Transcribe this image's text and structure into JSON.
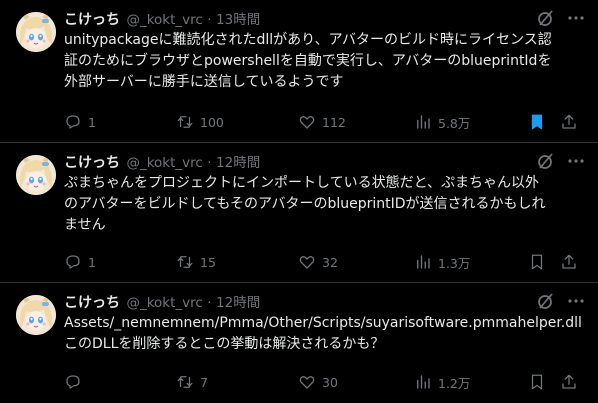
{
  "colors": {
    "background": "#000000",
    "text": "#e7e9ea",
    "muted": "#71767b",
    "accent": "#1d9bf0",
    "divider": "#2f3336"
  },
  "tweets": [
    {
      "name": "こけっち",
      "handle": "@_kokt_vrc",
      "separator": "·",
      "time": "13時間",
      "text": "unitypackageに難読化されたdllがあり、アバターのビルド時にライセンス認\n証のためにブラウザとpowershellを自動で実行し、アバターのblueprintIdを\n外部サーバーに勝手に送信しているようです",
      "replies": "1",
      "retweets": "100",
      "likes": "112",
      "views": "5.8万",
      "bookmarked": true
    },
    {
      "name": "こけっち",
      "handle": "@_kokt_vrc",
      "separator": "·",
      "time": "12時間",
      "text": "ぷまちゃんをプロジェクトにインポートしている状態だと、ぷまちゃん以外\nのアバターをビルドしてもそのアバターのblueprintIDが送信されるかもしれ\nません",
      "replies": "1",
      "retweets": "15",
      "likes": "32",
      "views": "1.3万",
      "bookmarked": false
    },
    {
      "name": "こけっち",
      "handle": "@_kokt_vrc",
      "separator": "·",
      "time": "12時間",
      "text": "Assets/_nemnemnem/Pmma/Other/Scripts/suyarisoftware.pmmahelper.dll\nこのDLLを削除するとこの挙動は解決されるかも？",
      "replies": "",
      "retweets": "7",
      "likes": "30",
      "views": "1.2万",
      "bookmarked": false
    }
  ]
}
